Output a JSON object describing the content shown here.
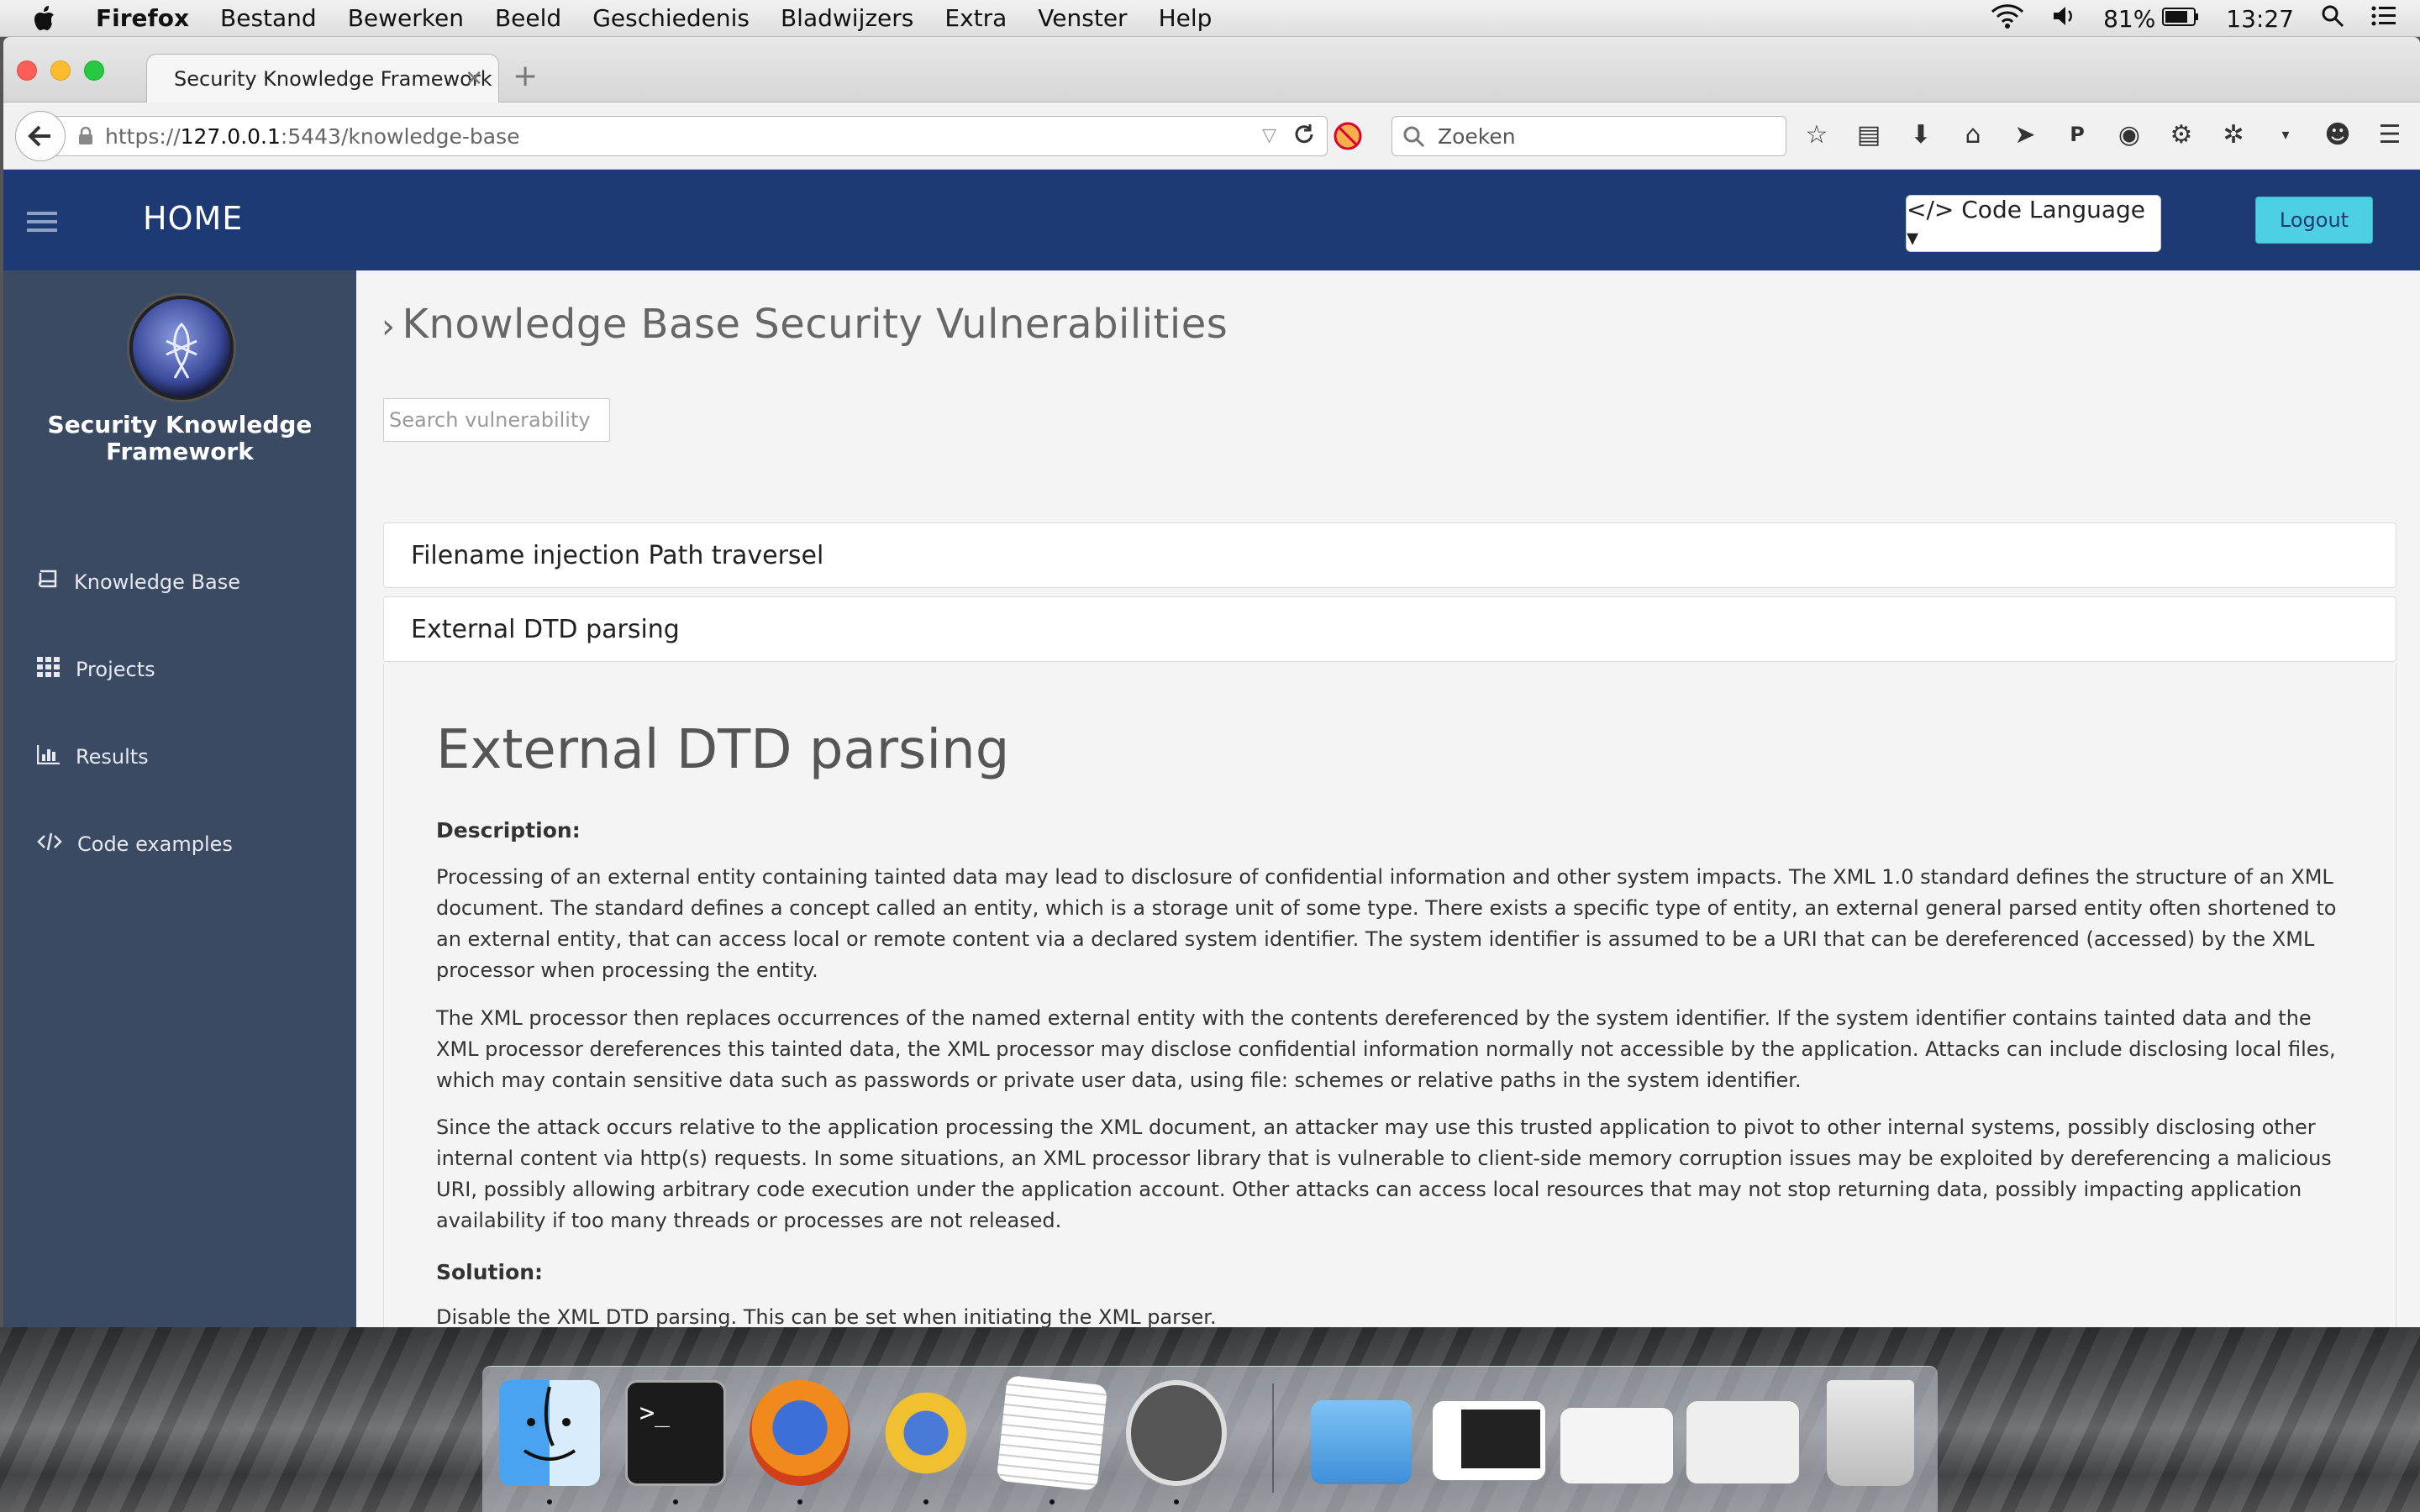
{
  "menubar": {
    "items": [
      "Firefox",
      "Bestand",
      "Bewerken",
      "Beeld",
      "Geschiedenis",
      "Bladwijzers",
      "Extra",
      "Venster",
      "Help"
    ],
    "battery": "81%",
    "clock": "13:27"
  },
  "browser": {
    "tab_title": "Security Knowledge Framework",
    "url_prefix": "https://",
    "url_host": "127.0.0.1",
    "url_rest": ":5443/knowledge-base",
    "search_placeholder": "Zoeken"
  },
  "app": {
    "header": {
      "home": "HOME",
      "code_language": "</> Code Language ▾",
      "logout": "Logout"
    },
    "sidebar": {
      "title_line1": "Security Knowledge",
      "title_line2": "Framework",
      "items": [
        {
          "label": "Knowledge Base",
          "icon": "book-icon"
        },
        {
          "label": "Projects",
          "icon": "grid-icon"
        },
        {
          "label": "Results",
          "icon": "bar-chart-icon"
        },
        {
          "label": "Code examples",
          "icon": "code-icon"
        }
      ]
    },
    "main": {
      "title": "Knowledge Base Security Vulnerabilities",
      "search_placeholder": "Search vulnerability",
      "items": [
        "Filename injection Path traversel",
        "External DTD parsing"
      ],
      "detail": {
        "heading": "External DTD parsing",
        "description_label": "Description:",
        "paragraphs": [
          "Processing of an external entity containing tainted data may lead to disclosure of confidential information and other system impacts. The XML 1.0 standard defines the structure of an XML document. The standard defines a concept called an entity, which is a storage unit of some type. There exists a specific type of entity, an external general parsed entity often shortened to an external entity, that can access local or remote content via a declared system identifier. The system identifier is assumed to be a URI that can be dereferenced (accessed) by the XML processor when processing the entity.",
          "The XML processor then replaces occurrences of the named external entity with the contents dereferenced by the system identifier. If the system identifier contains tainted data and the XML processor dereferences this tainted data, the XML processor may disclose confidential information normally not accessible by the application. Attacks can include disclosing local files, which may contain sensitive data such as passwords or private user data, using file: schemes or relative paths in the system identifier.",
          "Since the attack occurs relative to the application processing the XML document, an attacker may use this trusted application to pivot to other internal systems, possibly disclosing other internal content via http(s) requests. In some situations, an XML processor library that is vulnerable to client-side memory corruption issues may be exploited by dereferencing a malicious URI, possibly allowing arbitrary code execution under the application account. Other attacks can access local resources that may not stop returning data, possibly impacting application availability if too many threads or processes are not released."
        ],
        "solution_label": "Solution:",
        "solution": "Disable the XML DTD parsing. This can be set when initiating the XML parser."
      }
    }
  },
  "dock": {
    "apps": [
      "finder-icon",
      "terminal-icon",
      "firefox-icon",
      "wireshark-icon",
      "textedit-icon",
      "mamp-icon",
      "folder-icon",
      "window-thumb-1",
      "window-thumb-2",
      "window-thumb-3",
      "trash-icon"
    ]
  }
}
